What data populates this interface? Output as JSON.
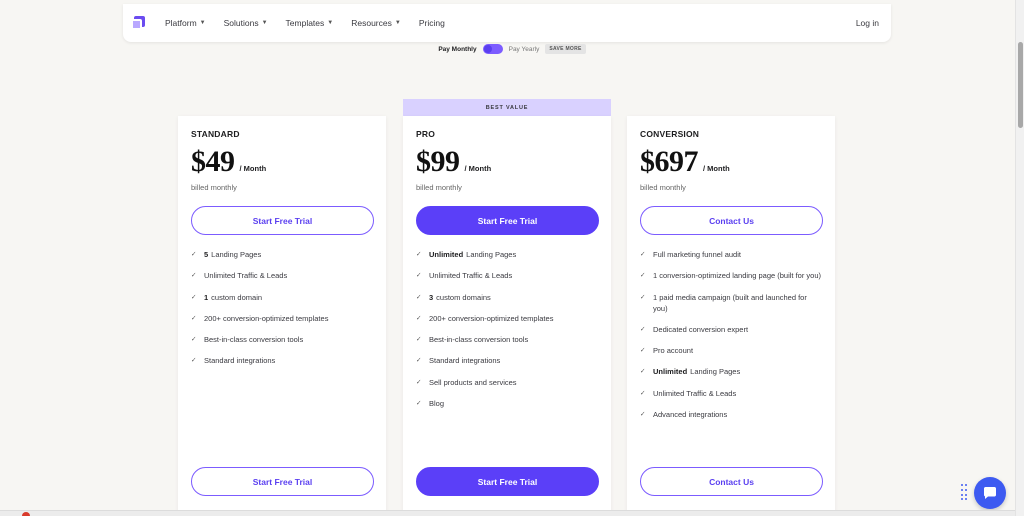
{
  "nav": {
    "items": [
      "Platform",
      "Solutions",
      "Templates",
      "Resources",
      "Pricing"
    ],
    "has_caret": [
      true,
      true,
      true,
      true,
      false
    ],
    "login": "Log in"
  },
  "billing_toggle": {
    "monthly": "Pay Monthly",
    "yearly": "Pay Yearly",
    "badge": "SAVE MORE",
    "selected": "monthly"
  },
  "best_value": "BEST VALUE",
  "plans": [
    {
      "name": "STANDARD",
      "price": "$49",
      "per": "/ Month",
      "billed": "billed monthly",
      "cta": "Start Free Trial",
      "cta_style": "outline",
      "features": [
        {
          "bold": "5",
          "text": "Landing Pages"
        },
        {
          "bold": "",
          "text": "Unlimited Traffic & Leads"
        },
        {
          "bold": "1",
          "text": "custom domain"
        },
        {
          "bold": "",
          "text": "200+ conversion-optimized templates"
        },
        {
          "bold": "",
          "text": "Best-in-class conversion tools"
        },
        {
          "bold": "",
          "text": "Standard integrations"
        }
      ]
    },
    {
      "name": "PRO",
      "price": "$99",
      "per": "/ Month",
      "billed": "billed monthly",
      "cta": "Start Free Trial",
      "cta_style": "filled",
      "features": [
        {
          "bold": "Unlimited",
          "text": "Landing Pages"
        },
        {
          "bold": "",
          "text": "Unlimited Traffic & Leads"
        },
        {
          "bold": "3",
          "text": "custom domains"
        },
        {
          "bold": "",
          "text": "200+ conversion-optimized templates"
        },
        {
          "bold": "",
          "text": "Best-in-class conversion tools"
        },
        {
          "bold": "",
          "text": "Standard integrations"
        },
        {
          "bold": "",
          "text": "Sell products and services"
        },
        {
          "bold": "",
          "text": "Blog"
        }
      ]
    },
    {
      "name": "CONVERSION",
      "price": "$697",
      "per": "/ Month",
      "billed": "billed monthly",
      "cta": "Contact Us",
      "cta_style": "outline",
      "features": [
        {
          "bold": "",
          "text": "Full marketing funnel audit"
        },
        {
          "bold": "",
          "text": "1 conversion-optimized landing page (built for you)"
        },
        {
          "bold": "",
          "text": "1 paid media campaign (built and launched for you)"
        },
        {
          "bold": "",
          "text": "Dedicated conversion expert"
        },
        {
          "bold": "",
          "text": "Pro account"
        },
        {
          "bold": "Unlimited",
          "text": "Landing Pages"
        },
        {
          "bold": "",
          "text": "Unlimited Traffic & Leads"
        },
        {
          "bold": "",
          "text": "Advanced integrations"
        }
      ]
    }
  ],
  "colors": {
    "accent": "#5b3ff8",
    "accent_light": "#d9d1ff",
    "chat": "#3d5af1"
  },
  "icons": {
    "check": "check-icon",
    "caret": "chevron-down-icon",
    "chat": "chat-bubble-icon"
  }
}
